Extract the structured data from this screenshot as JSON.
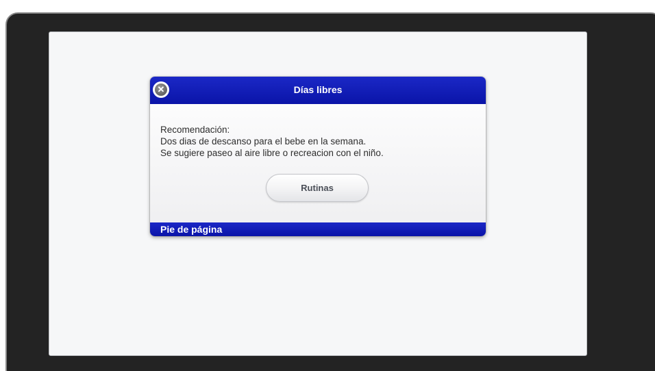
{
  "dialog": {
    "title": "Días libres",
    "close_glyph": "✕",
    "body_lines": [
      "Recomendación:",
      "Dos dias de descanso para el bebe en la semana.",
      "Se sugiere paseo al aire libre o recreacion con el niño."
    ],
    "primary_button_label": "Rutinas",
    "footer": "Pie de página"
  },
  "icons": {
    "close": "close-circle-icon"
  },
  "colors": {
    "header_blue": "#1b28c6",
    "device_frame": "#232323",
    "screen_background": "#f6f7f8"
  }
}
